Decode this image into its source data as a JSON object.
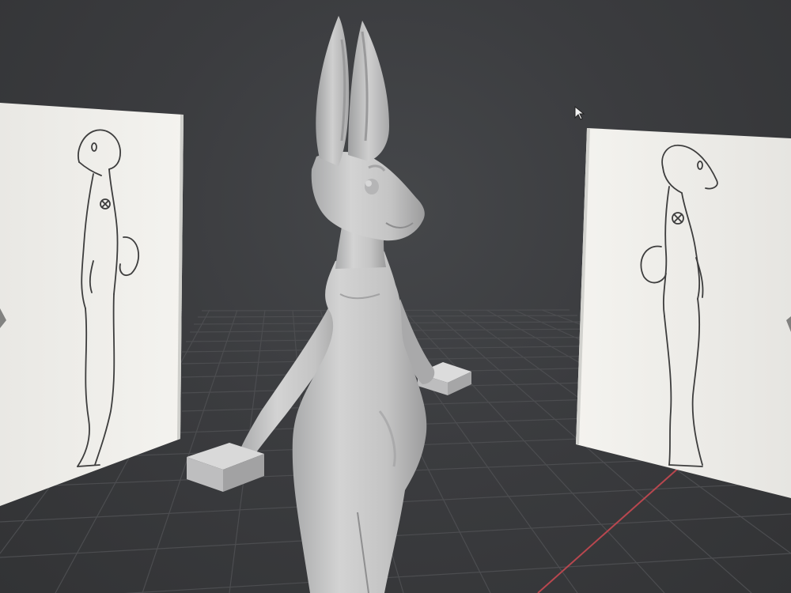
{
  "app": {
    "view": "3D viewport",
    "colors": {
      "background": "#3a3b3d",
      "grid_line": "#4a4b4e",
      "grid_axis_x": "#b8474f",
      "model": "#c9c9c9",
      "reference_paper": "#f1f0ec",
      "sketch_line": "#3a3a3a"
    }
  },
  "viewport": {
    "objects": [
      {
        "name": "rabbit-model",
        "kind": "sculpt mesh"
      },
      {
        "name": "reference-plane-left",
        "kind": "image plane"
      },
      {
        "name": "reference-plane-right",
        "kind": "image plane"
      },
      {
        "name": "hand-block-left",
        "kind": "cube"
      },
      {
        "name": "hand-block-right",
        "kind": "cube"
      }
    ],
    "cursor_icon": "arrow-pointer-icon"
  }
}
